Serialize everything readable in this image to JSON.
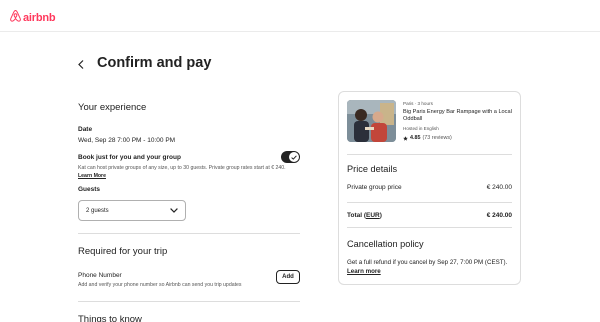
{
  "brand": {
    "name": "airbnb",
    "color": "#ff385c"
  },
  "page": {
    "title": "Confirm and pay"
  },
  "experience": {
    "section_title": "Your experience",
    "date_label": "Date",
    "date_value": "Wed, Sep 28 7:00 PM - 10:00 PM",
    "book_private_label": "Book just for you and your group",
    "book_private_toggle": true,
    "book_private_desc": "Kat can host private groups of any size, up to 30 guests. Private group rates start at € 240.",
    "learn_more": "Learn More",
    "guests_label": "Guests",
    "guests_value": "2 guests"
  },
  "required": {
    "section_title": "Required for your trip",
    "phone_label": "Phone Number",
    "phone_desc": "Add and verify your phone number so Airbnb can send you trip updates",
    "add_button": "Add"
  },
  "things": {
    "section_title": "Things to know"
  },
  "listing": {
    "subtitle": "Paris · 3 hours",
    "title": "Big Paris Energy Bar Rampage with a Local Oddball",
    "language": "Hosted in English",
    "rating": "4.85",
    "reviews": "(73 reviews)"
  },
  "price": {
    "section_title": "Price details",
    "item_label": "Private group price",
    "item_value": "€ 240.00",
    "total_label_prefix": "Total (",
    "total_currency": "EUR",
    "total_label_suffix": ")",
    "total_value": "€ 240.00"
  },
  "cancellation": {
    "section_title": "Cancellation policy",
    "text": "Get a full refund if you cancel by Sep 27, 7:00 PM (CEST).",
    "learn_more": "Learn more"
  }
}
